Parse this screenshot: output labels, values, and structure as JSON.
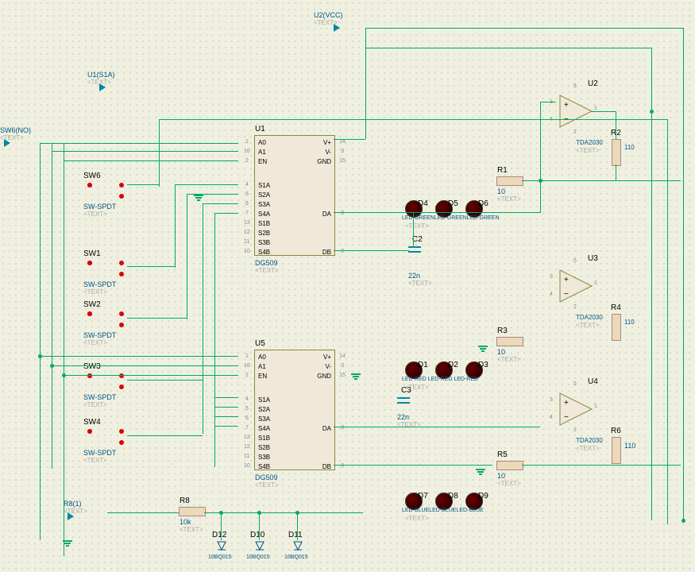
{
  "terminals": {
    "u2vcc": "U2(VCC)",
    "u1s1a": "U1(S1A)",
    "sw6no": "SW6(NO)",
    "r8_1": "R8(1)"
  },
  "placeholder_text": "<TEXT>",
  "switches": [
    {
      "ref": "SW6",
      "part": "SW-SPDT"
    },
    {
      "ref": "SW1",
      "part": "SW-SPDT"
    },
    {
      "ref": "SW2",
      "part": "SW-SPDT"
    },
    {
      "ref": "SW3",
      "part": "SW-SPDT"
    },
    {
      "ref": "SW4",
      "part": "SW-SPDT"
    }
  ],
  "ics": [
    {
      "ref": "U1",
      "part": "DG509",
      "pins": {
        "1": "A0",
        "16": "A1",
        "2": "EN",
        "14": "V+",
        "3": "V-",
        "15": "GND",
        "4": "S1A",
        "5": "S2A",
        "6": "S3A",
        "7": "S4A",
        "13": "S1B",
        "12": "S2B",
        "11": "S3B",
        "10": "S4B",
        "8": "DA",
        "9": "DB"
      }
    },
    {
      "ref": "U5",
      "part": "DG509",
      "pins": {
        "1": "A0",
        "16": "A1",
        "2": "EN",
        "14": "V+",
        "3": "V-",
        "15": "GND",
        "4": "S1A",
        "5": "S2A",
        "6": "S3A",
        "7": "S4A",
        "13": "S1B",
        "12": "S2B",
        "11": "S3B",
        "10": "S4B",
        "8": "DA",
        "9": "DB"
      }
    }
  ],
  "opamps": [
    {
      "ref": "U2",
      "part": "TDA2030"
    },
    {
      "ref": "U3",
      "part": "TDA2030"
    },
    {
      "ref": "U4",
      "part": "TDA2030"
    }
  ],
  "resistors": [
    {
      "ref": "R1",
      "value": "10"
    },
    {
      "ref": "R2",
      "value": "110"
    },
    {
      "ref": "R3",
      "value": "10"
    },
    {
      "ref": "R4",
      "value": "110"
    },
    {
      "ref": "R5",
      "value": "10"
    },
    {
      "ref": "R6",
      "value": "110"
    },
    {
      "ref": "R8",
      "value": "10k"
    }
  ],
  "caps": [
    {
      "ref": "C2",
      "value": "22n"
    },
    {
      "ref": "C3",
      "value": "22n"
    }
  ],
  "leds": [
    {
      "ref": "D4",
      "part": "LED-GREEN"
    },
    {
      "ref": "D5",
      "part": "LED-GREEN"
    },
    {
      "ref": "D6",
      "part": "LED-GREEN"
    },
    {
      "ref": "D1",
      "part": "LED-RED"
    },
    {
      "ref": "D2",
      "part": "LED-RED"
    },
    {
      "ref": "D3",
      "part": "LED-RED"
    },
    {
      "ref": "D7",
      "part": "LED-BLUE"
    },
    {
      "ref": "D8",
      "part": "LED-BLUE"
    },
    {
      "ref": "D9",
      "part": "LED-BLUE"
    }
  ],
  "diodes": [
    {
      "ref": "D12",
      "part": "10BQ015"
    },
    {
      "ref": "D10",
      "part": "10BQ015"
    },
    {
      "ref": "D11",
      "part": "10BQ015"
    }
  ]
}
